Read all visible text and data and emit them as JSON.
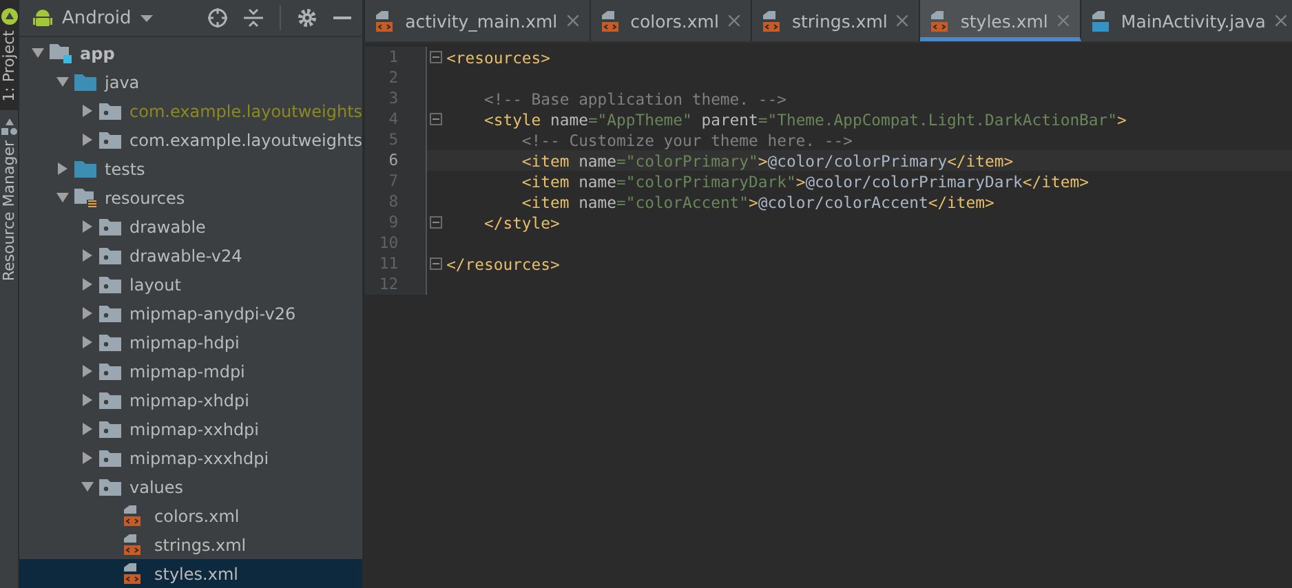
{
  "side_strip": {
    "tabs": [
      {
        "label": "1: Project",
        "selected": true
      },
      {
        "label": "Resource Manager",
        "selected": false
      }
    ]
  },
  "project_panel": {
    "view": "Android",
    "tree": [
      {
        "label": "app",
        "kind": "module",
        "expanded": true,
        "selected": false,
        "children": [
          {
            "label": "java",
            "kind": "source",
            "expanded": true,
            "selected": false,
            "children": [
              {
                "label": "com.example.layoutweights",
                "kind": "package",
                "expanded": false,
                "selected": false,
                "color": "#8c8a1d"
              },
              {
                "label": "com.example.layoutweights",
                "kind": "package",
                "expanded": false,
                "selected": false
              }
            ]
          },
          {
            "label": "tests",
            "kind": "source",
            "expanded": false,
            "selected": false
          },
          {
            "label": "resources",
            "kind": "res",
            "expanded": true,
            "selected": false,
            "children": [
              {
                "label": "drawable",
                "kind": "package",
                "expanded": false,
                "selected": false
              },
              {
                "label": "drawable-v24",
                "kind": "package",
                "expanded": false,
                "selected": false
              },
              {
                "label": "layout",
                "kind": "package",
                "expanded": false,
                "selected": false
              },
              {
                "label": "mipmap-anydpi-v26",
                "kind": "package",
                "expanded": false,
                "selected": false
              },
              {
                "label": "mipmap-hdpi",
                "kind": "package",
                "expanded": false,
                "selected": false
              },
              {
                "label": "mipmap-mdpi",
                "kind": "package",
                "expanded": false,
                "selected": false
              },
              {
                "label": "mipmap-xhdpi",
                "kind": "package",
                "expanded": false,
                "selected": false
              },
              {
                "label": "mipmap-xxhdpi",
                "kind": "package",
                "expanded": false,
                "selected": false
              },
              {
                "label": "mipmap-xxxhdpi",
                "kind": "package",
                "expanded": false,
                "selected": false
              },
              {
                "label": "values",
                "kind": "package",
                "expanded": true,
                "selected": false,
                "children": [
                  {
                    "label": "colors.xml",
                    "kind": "xml",
                    "selected": false
                  },
                  {
                    "label": "strings.xml",
                    "kind": "xml",
                    "selected": false
                  },
                  {
                    "label": "styles.xml",
                    "kind": "xml",
                    "selected": true
                  }
                ]
              }
            ]
          }
        ]
      }
    ]
  },
  "editor": {
    "tabs": [
      {
        "label": "activity_main.xml",
        "kind": "xml",
        "selected": false
      },
      {
        "label": "colors.xml",
        "kind": "xml",
        "selected": false
      },
      {
        "label": "strings.xml",
        "kind": "xml",
        "selected": false
      },
      {
        "label": "styles.xml",
        "kind": "xml",
        "selected": true
      },
      {
        "label": "MainActivity.java",
        "kind": "java",
        "selected": false
      }
    ],
    "lines": [
      {
        "number": "1",
        "fold": true,
        "current": false,
        "tokens": [
          {
            "kind": "tag",
            "text": "<resources>"
          }
        ]
      },
      {
        "number": "2",
        "fold": false,
        "current": false
      },
      {
        "number": "3",
        "fold": false,
        "current": false,
        "tokens": [
          {
            "kind": "comment",
            "text": "    <!-- Base application theme. -->"
          }
        ]
      },
      {
        "number": "4",
        "fold": true,
        "current": false,
        "tokens": [
          {
            "kind": "tag",
            "text": "    <style "
          },
          {
            "kind": "attr",
            "text": "name"
          },
          {
            "kind": "value",
            "text": "=\"AppTheme\" "
          },
          {
            "kind": "attr",
            "text": "parent"
          },
          {
            "kind": "value",
            "text": "=\"Theme.AppCompat.Light.DarkActionBar\""
          },
          {
            "kind": "tag",
            "text": ">"
          }
        ]
      },
      {
        "number": "5",
        "fold": false,
        "current": false,
        "tokens": [
          {
            "kind": "comment",
            "text": "        <!-- Customize your theme here. -->"
          }
        ]
      },
      {
        "number": "6",
        "fold": false,
        "current": true,
        "tokens": [
          {
            "kind": "tag",
            "text": "        <item "
          },
          {
            "kind": "attr",
            "text": "name"
          },
          {
            "kind": "value",
            "text": "=\"colorPrimary\""
          },
          {
            "kind": "tag",
            "text": ">"
          },
          {
            "kind": "text",
            "text": "@color/colorPrimary"
          },
          {
            "kind": "tag",
            "text": "</item>"
          }
        ]
      },
      {
        "number": "7",
        "fold": false,
        "current": false,
        "tokens": [
          {
            "kind": "tag",
            "text": "        <item "
          },
          {
            "kind": "attr",
            "text": "name"
          },
          {
            "kind": "value",
            "text": "=\"colorPrimaryDark\""
          },
          {
            "kind": "tag",
            "text": ">"
          },
          {
            "kind": "text",
            "text": "@color/colorPrimaryDark"
          },
          {
            "kind": "tag",
            "text": "</item>"
          }
        ]
      },
      {
        "number": "8",
        "fold": false,
        "current": false,
        "tokens": [
          {
            "kind": "tag",
            "text": "        <item "
          },
          {
            "kind": "attr",
            "text": "name"
          },
          {
            "kind": "value",
            "text": "=\"colorAccent\""
          },
          {
            "kind": "tag",
            "text": ">"
          },
          {
            "kind": "text",
            "text": "@color/colorAccent"
          },
          {
            "kind": "tag",
            "text": "</item>"
          }
        ]
      },
      {
        "number": "9",
        "fold": true,
        "current": false,
        "tokens": [
          {
            "kind": "tag",
            "text": "    </style>"
          }
        ]
      },
      {
        "number": "10",
        "fold": false,
        "current": false
      },
      {
        "number": "11",
        "fold": true,
        "current": false,
        "tokens": [
          {
            "kind": "tag",
            "text": "</resources>"
          }
        ]
      },
      {
        "number": "12",
        "fold": false,
        "current": false
      }
    ]
  }
}
